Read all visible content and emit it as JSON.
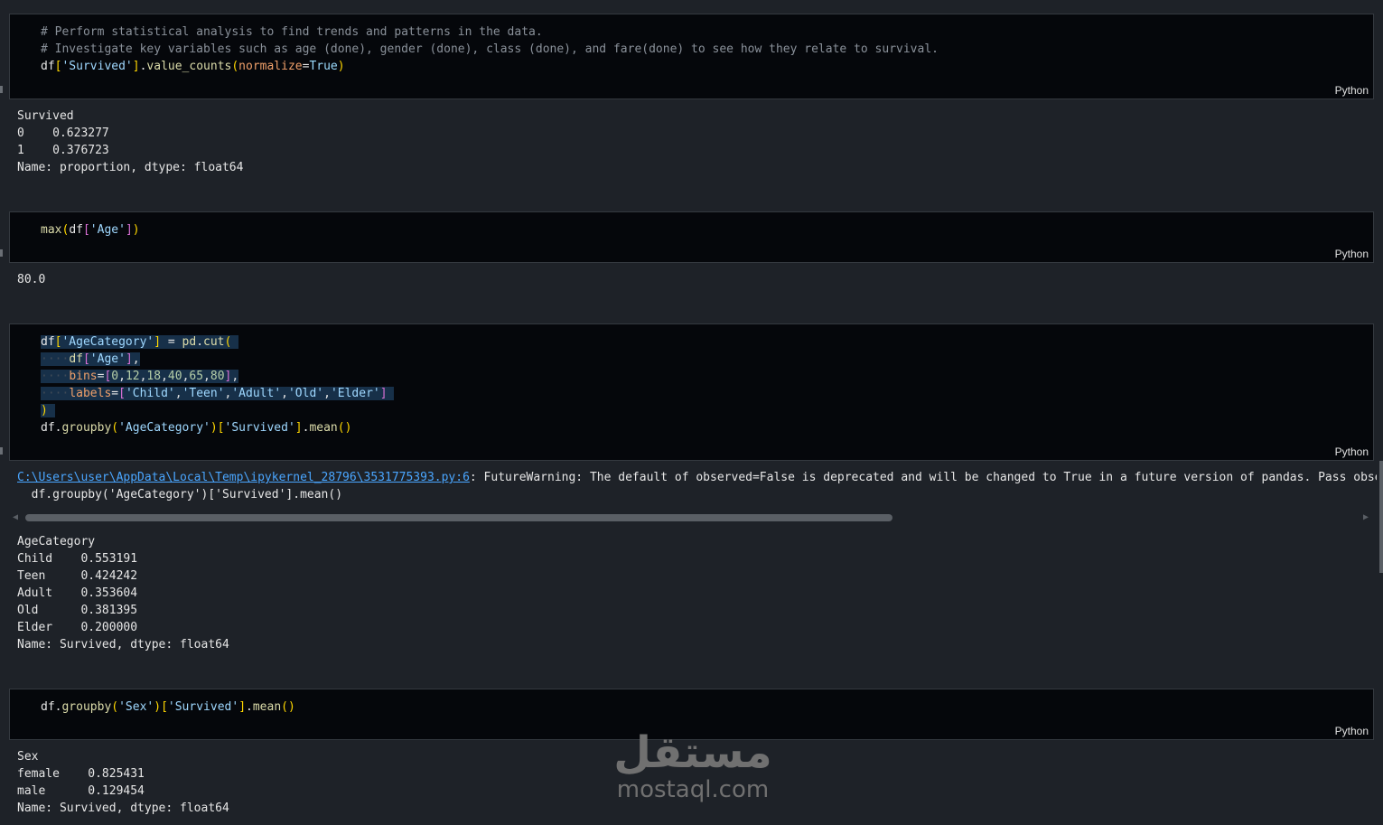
{
  "cells": [
    {
      "lang": "Python",
      "comment1": "# Perform statistical analysis to find trends and patterns in the data.",
      "comment2": "# Investigate key variables such as age (done), gender (done), class (done), and fare(done) to see how they relate to survival.",
      "code_df": "df",
      "code_str": "'Survived'",
      "code_method": "value_counts",
      "code_kwarg": "normalize",
      "code_val": "True"
    },
    {
      "lang": "Python",
      "code_fn": "max",
      "code_df": "df",
      "code_str": "'Age'"
    },
    {
      "lang": "Python",
      "line1_df": "df",
      "line1_str": "'AgeCategory'",
      "line1_pd": "pd",
      "line1_cut": "cut",
      "line2_df": "df",
      "line2_str": "'Age'",
      "line3_kw": "bins",
      "line3_vals": [
        "0",
        "12",
        "18",
        "40",
        "65",
        "80"
      ],
      "line4_kw": "labels",
      "line4_vals": [
        "'Child'",
        "'Teen'",
        "'Adult'",
        "'Old'",
        "'Elder'"
      ],
      "line6_df": "df",
      "line6_method": "groupby",
      "line6_str1": "'AgeCategory'",
      "line6_str2": "'Survived'",
      "line6_mean": "mean"
    },
    {
      "lang": "Python",
      "code_df": "df",
      "code_method": "groupby",
      "code_str1": "'Sex'",
      "code_str2": "'Survived'",
      "code_mean": "mean"
    }
  ],
  "outputs": {
    "survived": [
      "Survived",
      "0    0.623277",
      "1    0.376723",
      "Name: proportion, dtype: float64"
    ],
    "max_age": "80.0",
    "warning_path": "C:\\Users\\user\\AppData\\Local\\Temp\\ipykernel_28796\\3531775393.py:6",
    "warning_text": ": FutureWarning: The default of observed=False is deprecated and will be changed to True in a future version of pandas. Pass observe",
    "warning_code": "  df.groupby('AgeCategory')['Survived'].mean()",
    "age_category": [
      "AgeCategory",
      "Child    0.553191",
      "Teen     0.424242",
      "Adult    0.353604",
      "Old      0.381395",
      "Elder    0.200000",
      "Name: Survived, dtype: float64"
    ],
    "sex": [
      "Sex",
      "female    0.825431",
      "male      0.129454",
      "Name: Survived, dtype: float64"
    ]
  },
  "watermark": {
    "arabic": "مستقل",
    "latin": "mostaql.com"
  }
}
